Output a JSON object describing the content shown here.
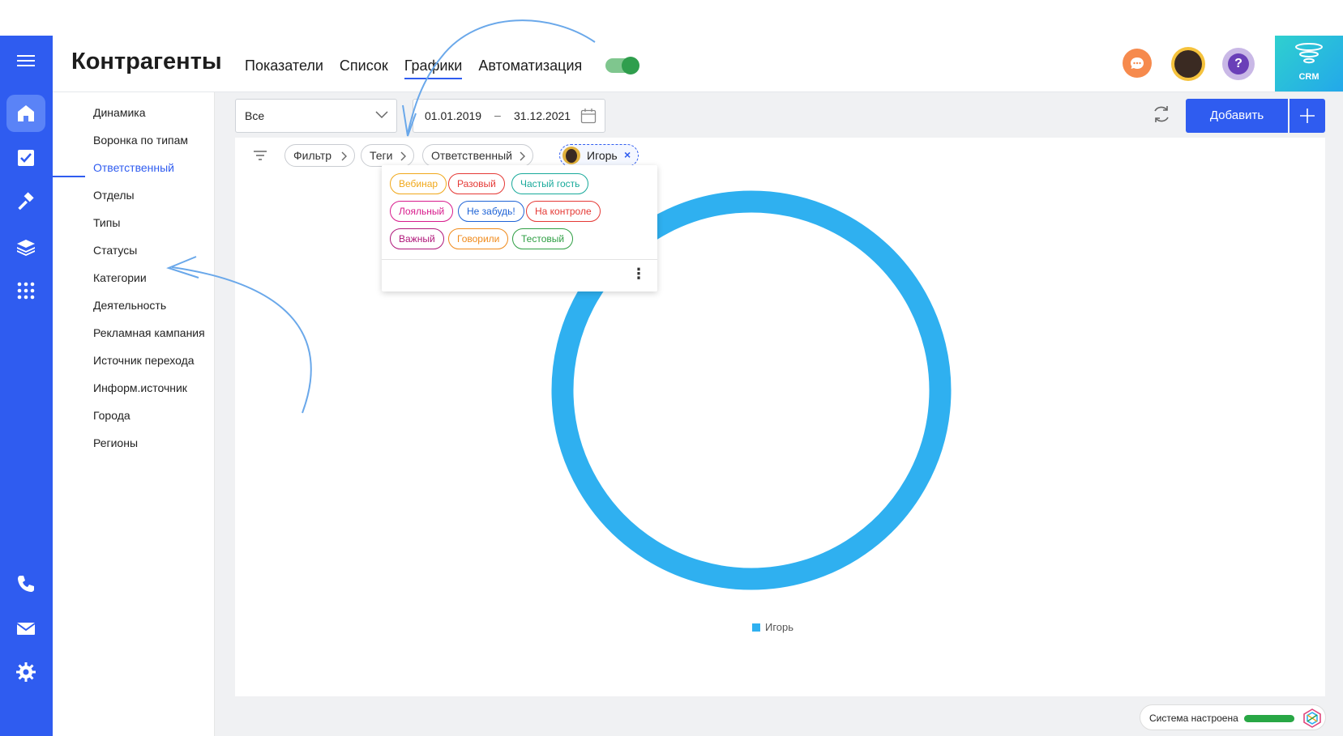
{
  "app": {
    "page_title": "Контрагенты",
    "crm_label": "CRM"
  },
  "nav": {
    "tabs": [
      {
        "label": "Показатели"
      },
      {
        "label": "Список"
      },
      {
        "label": "Графики"
      },
      {
        "label": "Автоматизация"
      }
    ],
    "active_tab": "Графики",
    "toggle_on": true
  },
  "rail": {
    "icons": [
      "menu-icon",
      "home-icon",
      "checkbox-icon",
      "hammer-icon",
      "layers-icon",
      "apps-grid-icon",
      "phone-icon",
      "mail-icon",
      "gear-icon"
    ],
    "active_icon": "home-icon"
  },
  "subnav": {
    "items": [
      {
        "label": "Динамика"
      },
      {
        "label": "Воронка по типам"
      },
      {
        "label": "Ответственный"
      },
      {
        "label": "Отделы"
      },
      {
        "label": "Типы"
      },
      {
        "label": "Статусы"
      },
      {
        "label": "Категории"
      },
      {
        "label": "Деятельность"
      },
      {
        "label": "Рекламная кампания"
      },
      {
        "label": "Источник перехода"
      },
      {
        "label": "Информ.источник"
      },
      {
        "label": "Города"
      },
      {
        "label": "Регионы"
      }
    ],
    "active_item": "Ответственный"
  },
  "toolbar": {
    "select_value": "Все",
    "date_from": "01.01.2019",
    "date_dash": "–",
    "date_to": "31.12.2021",
    "add_label": "Добавить"
  },
  "filters": {
    "chips": [
      {
        "label": "Фильтр"
      },
      {
        "label": "Теги"
      },
      {
        "label": "Ответственный"
      }
    ],
    "user_chip": {
      "label": "Игорь",
      "remove": "×"
    }
  },
  "tags_popup": {
    "tags": [
      {
        "label": "Вебинар",
        "color": "#f0a81a"
      },
      {
        "label": "Разовый",
        "color": "#e53935"
      },
      {
        "label": "Частый гость",
        "color": "#17a99a"
      },
      {
        "label": "Лояльный",
        "color": "#d81b8c"
      },
      {
        "label": "Не забудь!",
        "color": "#1e63d6"
      },
      {
        "label": "На контроле",
        "color": "#e53935"
      },
      {
        "label": "Важный",
        "color": "#b0177a"
      },
      {
        "label": "Говорили",
        "color": "#f08a1a"
      },
      {
        "label": "Тестовый",
        "color": "#2e9e43"
      }
    ],
    "more": "⋮"
  },
  "chart_data": {
    "type": "pie",
    "style": "donut",
    "categories": [
      "Игорь"
    ],
    "values": [
      100
    ],
    "colors": [
      "#2fb0f0"
    ],
    "legend": "bottom"
  },
  "status": {
    "text": "Система настроена",
    "progress": 1.0,
    "bar_color": "#28a745"
  },
  "colors": {
    "accent": "#2f5cf0",
    "rail_bg": "#2f5cf0",
    "donut": "#2fb0f0"
  }
}
